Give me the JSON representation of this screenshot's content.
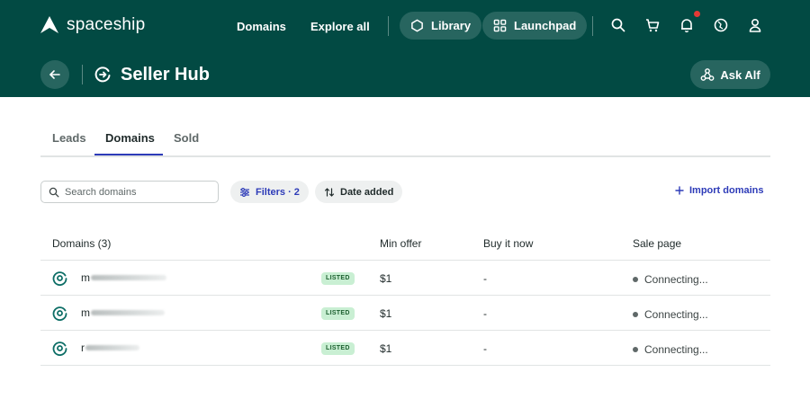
{
  "brand": {
    "name": "spaceship"
  },
  "nav": {
    "domains": "Domains",
    "explore": "Explore all",
    "library": "Library",
    "launchpad": "Launchpad"
  },
  "page": {
    "title": "Seller Hub",
    "ask_label": "Ask Alf"
  },
  "tabs": [
    {
      "label": "Leads",
      "active": false
    },
    {
      "label": "Domains",
      "active": true
    },
    {
      "label": "Sold",
      "active": false
    }
  ],
  "toolbar": {
    "search_placeholder": "Search domains",
    "filters_label": "Filters · 2",
    "date_label": "Date added",
    "import_label": "Import domains"
  },
  "table": {
    "columns": [
      "Domains (3)",
      "Min offer",
      "Buy it now",
      "Sale page"
    ],
    "rows": [
      {
        "name_prefix": "m",
        "badge": "LISTED",
        "min_offer": "$1",
        "buy_now": "-",
        "sale_page": "Connecting..."
      },
      {
        "name_prefix": "m",
        "badge": "LISTED",
        "min_offer": "$1",
        "buy_now": "-",
        "sale_page": "Connecting..."
      },
      {
        "name_prefix": "r",
        "badge": "LISTED",
        "min_offer": "$1",
        "buy_now": "-",
        "sale_page": "Connecting..."
      }
    ]
  },
  "colors": {
    "header_bg": "#024a43",
    "accent": "#2d3bb8",
    "listed_bg": "#c9efd3",
    "notification": "#e53935"
  },
  "icons": [
    "spaceship-logo-icon",
    "hexagon-icon",
    "grid-icon",
    "search-icon",
    "cart-icon",
    "bell-icon",
    "globe-icon",
    "user-icon",
    "arrow-left-icon",
    "seller-hub-icon",
    "alf-icon",
    "sliders-icon",
    "sort-icon",
    "plus-icon",
    "domain-status-icon"
  ]
}
